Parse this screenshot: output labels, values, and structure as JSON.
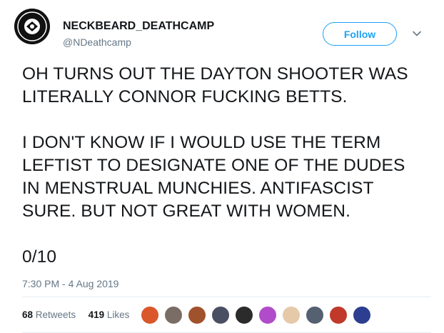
{
  "tweet": {
    "display_name": "NECKBEARD_DEATHCAMP",
    "handle": "@NDeathcamp",
    "follow_label": "Follow",
    "text": "OH TURNS OUT THE DAYTON SHOOTER WAS\nLITERALLY CONNOR FUCKING BETTS.\n\nI DON'T KNOW IF I WOULD USE THE TERM\nLEFTIST TO DESIGNATE ONE OF THE DUDES\nIN MENSTRUAL MUNCHIES. ANTIFASCIST\nSURE. BUT NOT GREAT WITH WOMEN.\n\n0/10",
    "timestamp": "7:30 PM - 4 Aug 2019",
    "retweets_count": "68",
    "retweets_label": "Retweets",
    "likes_count": "419",
    "likes_label": "Likes"
  },
  "icons": {
    "avatar": "neckbeard-deathcamp-logo",
    "chevron": "chevron-down-icon"
  },
  "liker_colors": [
    "#d9572b",
    "#7a6d66",
    "#a0522d",
    "#4a4f63",
    "#2b2b2b",
    "#b04cc9",
    "#e6c9a8",
    "#556070",
    "#c0392b",
    "#2c3e8f"
  ],
  "colors": {
    "accent": "#1da1f2",
    "text": "#14171a",
    "muted": "#657786"
  }
}
